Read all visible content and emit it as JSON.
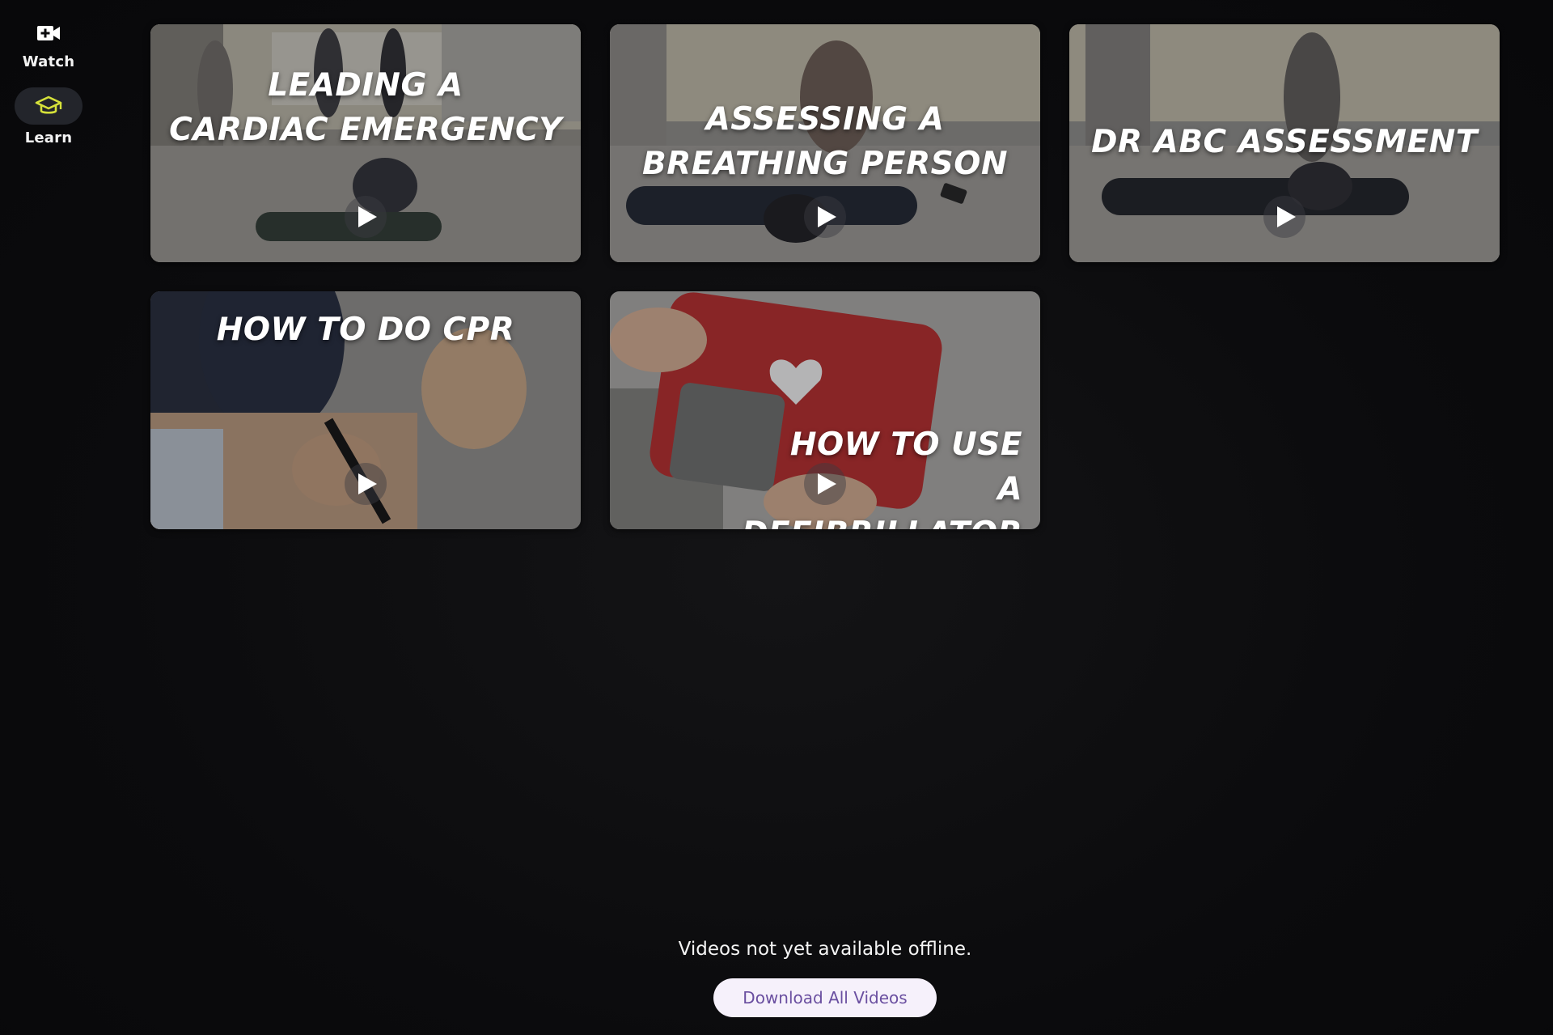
{
  "sidebar": {
    "items": [
      {
        "label": "Watch",
        "icon": "video-plus-icon",
        "active": false
      },
      {
        "label": "Learn",
        "icon": "graduation-cap-icon",
        "active": true
      }
    ],
    "accent": "#d6e23a"
  },
  "videos": [
    {
      "title": "LEADING A\nCARDIAC EMERGENCY"
    },
    {
      "title": "ASSESSING A\nBREATHING PERSON"
    },
    {
      "title": "DR ABC ASSESSMENT"
    },
    {
      "title": "HOW TO DO CPR"
    },
    {
      "title": "HOW TO USE\nA DEFIBRILLATOR"
    }
  ],
  "footer": {
    "offline_text": "Videos not yet available offline.",
    "download_label": "Download All Videos"
  }
}
